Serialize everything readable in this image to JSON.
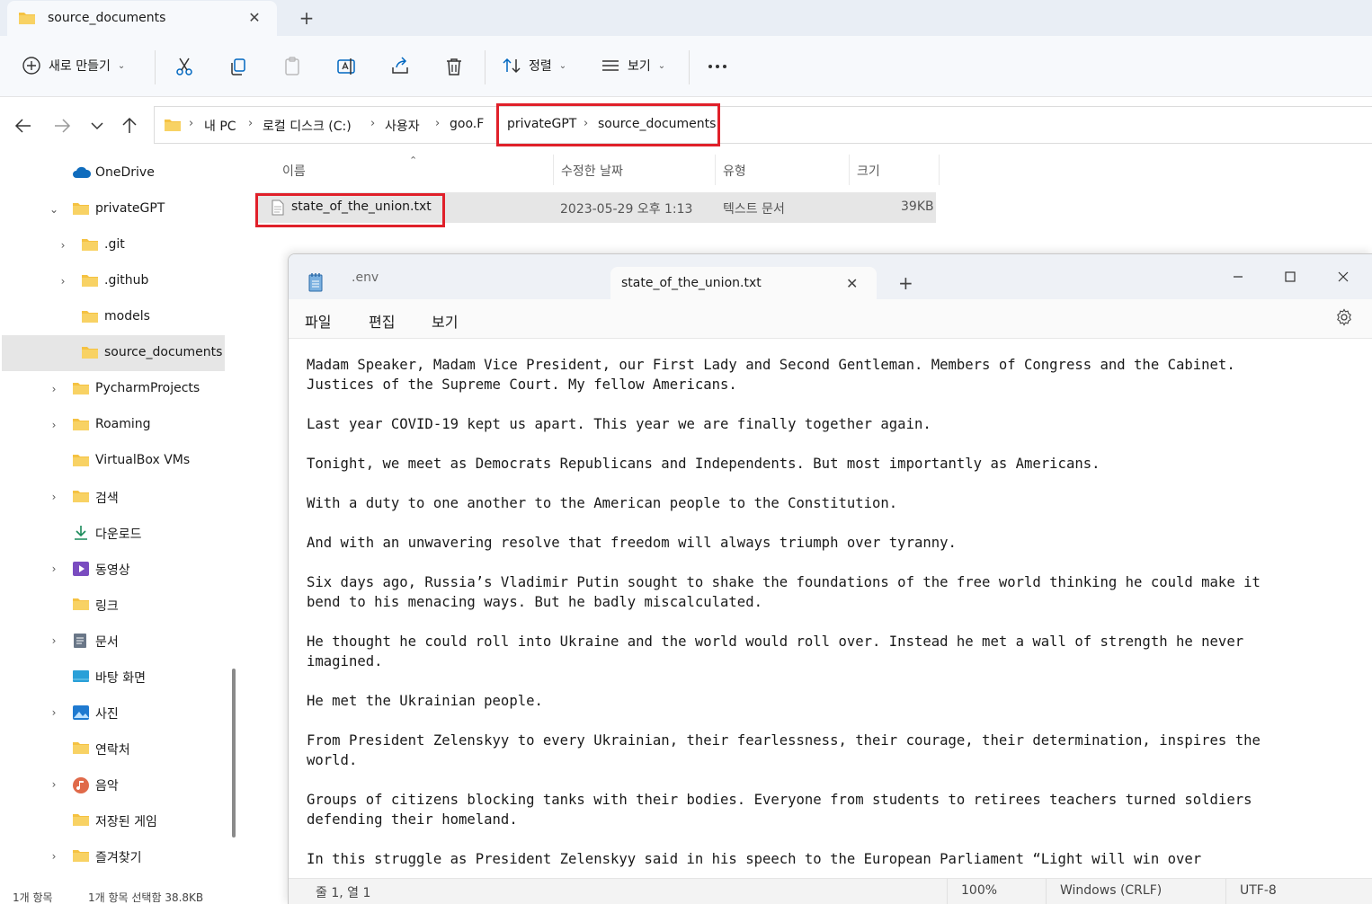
{
  "explorer": {
    "tab_title": "source_documents",
    "toolbar": {
      "new_label": "새로 만들기",
      "sort_label": "정렬",
      "view_label": "보기"
    },
    "breadcrumb": [
      "내 PC",
      "로컬 디스크 (C:)",
      "사용자",
      "goo.F",
      "privateGPT",
      "source_documents"
    ],
    "sidebar": [
      {
        "label": "OneDrive",
        "icon": "cloud-icon"
      },
      {
        "label": "privateGPT",
        "icon": "folder-icon"
      },
      {
        "label": ".git",
        "icon": "folder-icon"
      },
      {
        "label": ".github",
        "icon": "folder-icon"
      },
      {
        "label": "models",
        "icon": "folder-icon"
      },
      {
        "label": "source_documents",
        "icon": "folder-icon"
      },
      {
        "label": "PycharmProjects",
        "icon": "folder-icon"
      },
      {
        "label": "Roaming",
        "icon": "folder-icon"
      },
      {
        "label": "VirtualBox VMs",
        "icon": "folder-icon"
      },
      {
        "label": "검색",
        "icon": "folder-icon"
      },
      {
        "label": "다운로드",
        "icon": "download-icon"
      },
      {
        "label": "동영상",
        "icon": "video-icon"
      },
      {
        "label": "링크",
        "icon": "folder-icon"
      },
      {
        "label": "문서",
        "icon": "document-icon"
      },
      {
        "label": "바탕 화면",
        "icon": "desktop-icon"
      },
      {
        "label": "사진",
        "icon": "picture-icon"
      },
      {
        "label": "연락처",
        "icon": "folder-icon"
      },
      {
        "label": "음악",
        "icon": "music-icon"
      },
      {
        "label": "저장된 게임",
        "icon": "folder-icon"
      },
      {
        "label": "즐겨찾기",
        "icon": "folder-icon"
      }
    ],
    "columns": [
      "이름",
      "수정한 날짜",
      "유형",
      "크기"
    ],
    "files": [
      {
        "name": "state_of_the_union.txt",
        "modified": "2023-05-29 오후 1:13",
        "type": "텍스트 문서",
        "size": "39KB"
      }
    ],
    "status_count": "1개 항목",
    "status_selected": "1개 항목 선택함 38.8KB"
  },
  "notepad": {
    "tabs": [
      {
        "label": ".env",
        "active": false
      },
      {
        "label": "state_of_the_union.txt",
        "active": true
      }
    ],
    "menu": [
      "파일",
      "편집",
      "보기"
    ],
    "content": "Madam Speaker, Madam Vice President, our First Lady and Second Gentleman. Members of Congress and the Cabinet.\nJustices of the Supreme Court. My fellow Americans.\n\nLast year COVID-19 kept us apart. This year we are finally together again.\n\nTonight, we meet as Democrats Republicans and Independents. But most importantly as Americans.\n\nWith a duty to one another to the American people to the Constitution.\n\nAnd with an unwavering resolve that freedom will always triumph over tyranny.\n\nSix days ago, Russia’s Vladimir Putin sought to shake the foundations of the free world thinking he could make it\nbend to his menacing ways. But he badly miscalculated.\n\nHe thought he could roll into Ukraine and the world would roll over. Instead he met a wall of strength he never\nimagined.\n\nHe met the Ukrainian people.\n\nFrom President Zelenskyy to every Ukrainian, their fearlessness, their courage, their determination, inspires the\nworld.\n\nGroups of citizens blocking tanks with their bodies. Everyone from students to retirees teachers turned soldiers\ndefending their homeland.\n\nIn this struggle as President Zelenskyy said in his speech to the European Parliament “Light will win over",
    "status": {
      "position": "줄 1, 열 1",
      "zoom": "100%",
      "line_ending": "Windows (CRLF)",
      "encoding": "UTF-8"
    }
  },
  "colors": {
    "folder": "#f5c242",
    "highlight": "#e0202a",
    "accent": "#0067c0"
  }
}
